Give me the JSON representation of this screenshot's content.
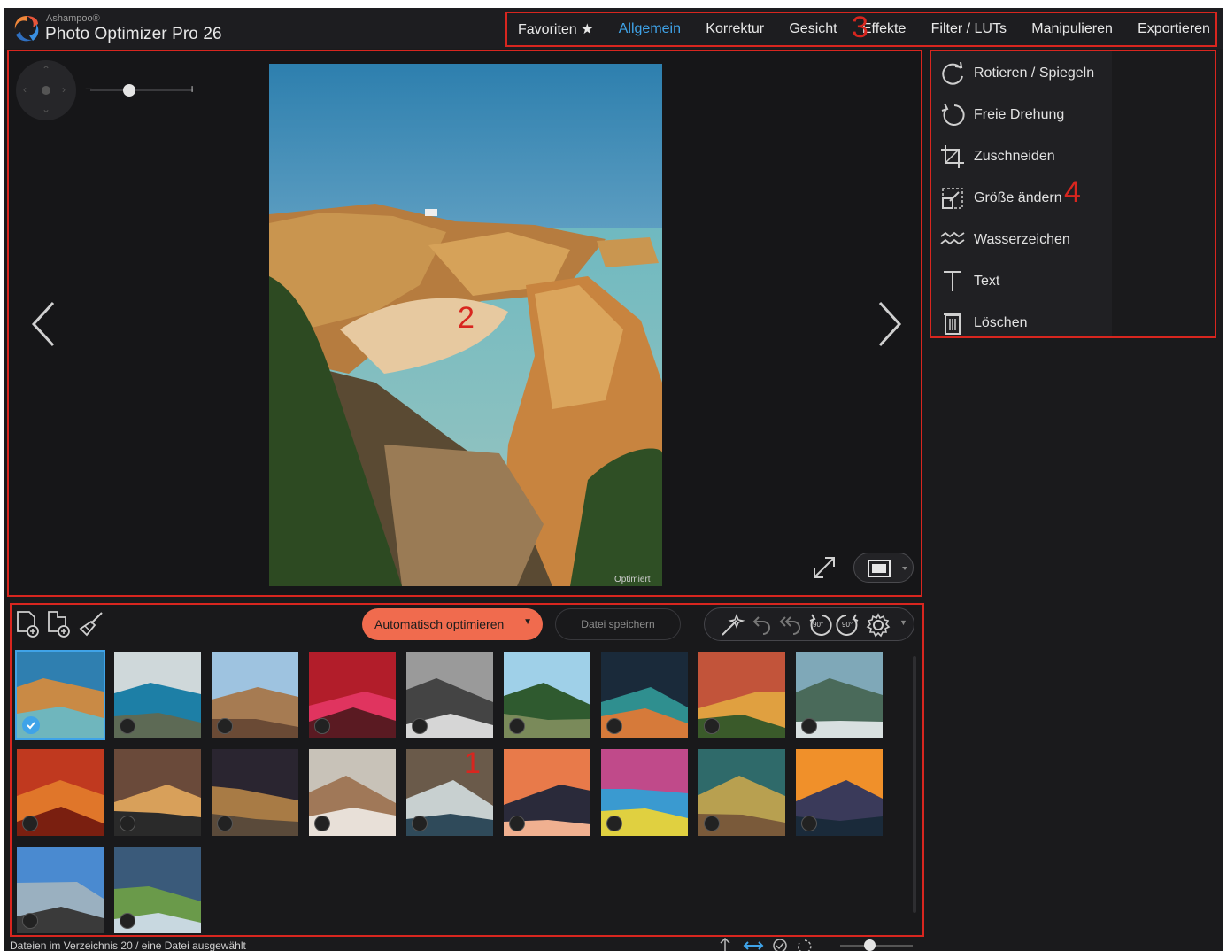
{
  "app": {
    "vendor": "Ashampoo®",
    "title": "Photo Optimizer Pro 26"
  },
  "tabs": [
    {
      "label": "Favoriten ★",
      "active": false
    },
    {
      "label": "Allgemein",
      "active": true
    },
    {
      "label": "Korrektur",
      "active": false
    },
    {
      "label": "Gesicht",
      "active": false
    },
    {
      "label": "Effekte",
      "active": false
    },
    {
      "label": "Filter / LUTs",
      "active": false
    },
    {
      "label": "Manipulieren",
      "active": false
    },
    {
      "label": "Exportieren",
      "active": false
    }
  ],
  "viewer": {
    "zoom_minus": "−",
    "zoom_plus": "+",
    "zoom_level": 0.38,
    "image_caption": "Optimiert"
  },
  "tools": [
    {
      "label": "Rotieren / Spiegeln",
      "icon": "rotate-flip-icon"
    },
    {
      "label": "Freie Drehung",
      "icon": "free-rotate-icon"
    },
    {
      "label": "Zuschneiden",
      "icon": "crop-icon"
    },
    {
      "label": "Größe ändern",
      "icon": "resize-icon"
    },
    {
      "label": "Wasserzeichen",
      "icon": "watermark-icon"
    },
    {
      "label": "Text",
      "icon": "text-icon"
    },
    {
      "label": "Löschen",
      "icon": "trash-icon"
    }
  ],
  "annotations": {
    "m1": "1",
    "m2": "2",
    "m3": "3",
    "m4": "4"
  },
  "browser": {
    "optimize_label": "Automatisch optimieren",
    "save_label": "Datei speichern",
    "rotate_left_label": "90°",
    "rotate_right_label": "90°",
    "thumbnail_count": 20,
    "selected_index": 0
  },
  "status": {
    "text": "Dateien im Verzeichnis 20 / eine Datei ausgewählt",
    "thumb_size_level": 0.4
  },
  "colors": {
    "accent": "#3fa3e8",
    "optimize": "#f06b4e",
    "annotation": "#d8261f"
  }
}
